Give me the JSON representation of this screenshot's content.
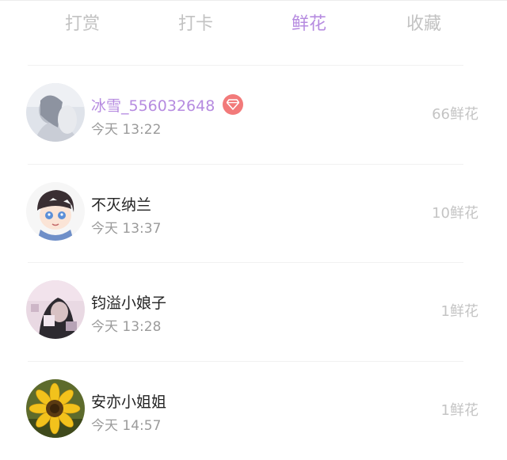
{
  "tabs": [
    {
      "label": "打赏",
      "active": false
    },
    {
      "label": "打卡",
      "active": false
    },
    {
      "label": "鲜花",
      "active": true
    },
    {
      "label": "收藏",
      "active": false
    }
  ],
  "colors": {
    "accent": "#b68be0",
    "tab_inactive": "#c2c2c2",
    "vip_badge": "#f27a7a",
    "amount": "#c4c4c4"
  },
  "list": [
    {
      "name": "冰雪_556032648",
      "vip": true,
      "badge_icon": "diamond-icon",
      "time": "今天 13:22",
      "amount": "66鲜花"
    },
    {
      "name": "不灭纳兰",
      "vip": false,
      "time": "今天 13:37",
      "amount": "10鲜花"
    },
    {
      "name": "钧溢小娘子",
      "vip": false,
      "time": "今天 13:28",
      "amount": "1鲜花"
    },
    {
      "name": "安亦小姐姐",
      "vip": false,
      "time": "今天 14:57",
      "amount": "1鲜花"
    }
  ]
}
